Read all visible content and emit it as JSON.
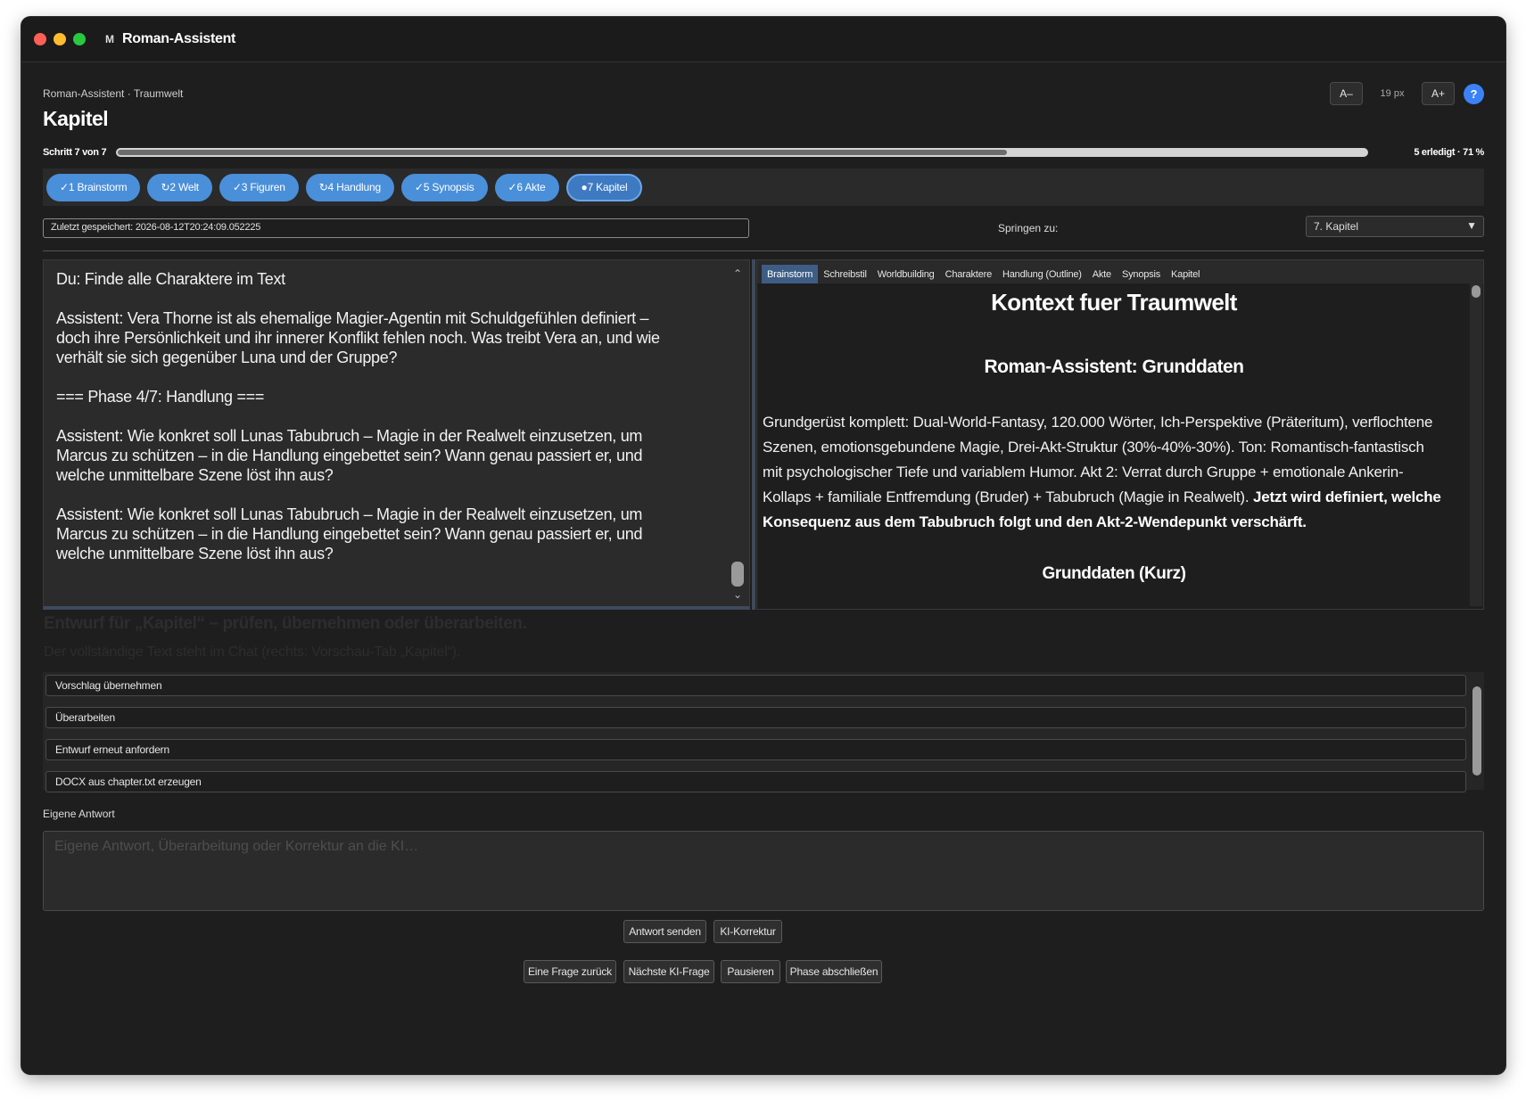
{
  "window": {
    "app_icon": "M",
    "title": "Roman-Assistent"
  },
  "header": {
    "breadcrumb": "Roman-Assistent · Traumwelt",
    "page_title": "Kapitel",
    "font_decrease": "A–",
    "font_size": "19 px",
    "font_increase": "A+",
    "help": "?"
  },
  "progress": {
    "step_label": "Schritt 7 von 7",
    "done_label": "5 erledigt · 71 %",
    "fraction": 0.71
  },
  "phases": [
    {
      "label": "✓1 Brainstorm",
      "active": false
    },
    {
      "label": "↻2 Welt",
      "active": false
    },
    {
      "label": "✓3 Figuren",
      "active": false
    },
    {
      "label": "↻4 Handlung",
      "active": false
    },
    {
      "label": "✓5 Synopsis",
      "active": false
    },
    {
      "label": "✓6 Akte",
      "active": false
    },
    {
      "label": "●7 Kapitel",
      "active": true
    }
  ],
  "saved": {
    "value": "Zuletzt gespeichert: 2026-08-12T20:24:09.052225"
  },
  "jump": {
    "label": "Springen zu:",
    "selected": "7. Kapitel"
  },
  "chat": {
    "messages": [
      "Du: Finde alle Charaktere im Text",
      "Assistent: Vera Thorne ist als ehemalige Magier-Agentin mit Schuldgefühlen definiert – doch ihre Persönlichkeit und ihr innerer Konflikt fehlen noch. Was treibt Vera an, und wie verhält sie sich gegenüber Luna und der Gruppe?",
      "=== Phase 4/7: Handlung ===",
      "Assistent: Wie konkret soll Lunas Tabubruch – Magie in der Realwelt einzusetzen, um Marcus zu schützen – in die Handlung eingebettet sein? Wann genau passiert er, und welche unmittelbare Szene löst ihn aus?",
      "Assistent: Wie konkret soll Lunas Tabubruch – Magie in der Realwelt einzusetzen, um Marcus zu schützen – in die Handlung eingebettet sein? Wann genau passiert er, und welche unmittelbare Szene löst ihn aus?"
    ]
  },
  "preview": {
    "tabs": [
      "Brainstorm",
      "Schreibstil",
      "Worldbuilding",
      "Charaktere",
      "Handlung (Outline)",
      "Akte",
      "Synopsis",
      "Kapitel"
    ],
    "active_tab": 0,
    "heading1": "Kontext fuer Traumwelt",
    "heading2": "Roman-Assistent: Grunddaten",
    "paragraph": "Grundgerüst komplett: Dual-World-Fantasy, 120.000 Wörter, Ich-Perspektive (Präteritum), verflochtene Szenen, emotionsgebundene Magie, Drei-Akt-Struktur (30%-40%-30%). Ton: Romantisch-fantastisch mit psychologischer Tiefe und variablem Humor. Akt 2: Verrat durch Gruppe + emotionale Ankerin-Kollaps + familiale Entfremdung (Bruder) + Tabubruch (Magie in Realwelt).",
    "paragraph_bold": "Jetzt wird definiert, welche Konsequenz aus dem Tabubruch folgt und den Akt-2-Wendepunkt verschärft.",
    "heading3": "Grunddaten (Kurz)"
  },
  "draft": {
    "title": "Entwurf für „Kapitel“ – prüfen, übernehmen oder überarbeiten.",
    "subtitle": "Der vollständige Text steht im Chat (rechts: Vorschau-Tab „Kapitel“)."
  },
  "actions": [
    "Vorschlag übernehmen",
    "Überarbeiten",
    "Entwurf erneut anfordern",
    "DOCX aus chapter.txt erzeugen"
  ],
  "own_answer": {
    "label": "Eigene Antwort",
    "placeholder": "Eigene Antwort, Überarbeitung oder Korrektur an die KI…"
  },
  "buttons": {
    "send": "Antwort senden",
    "ki_correction": "KI-Korrektur",
    "back": "Eine Frage zurück",
    "next": "Nächste KI-Frage",
    "pause": "Pausieren",
    "finish": "Phase abschließen"
  }
}
